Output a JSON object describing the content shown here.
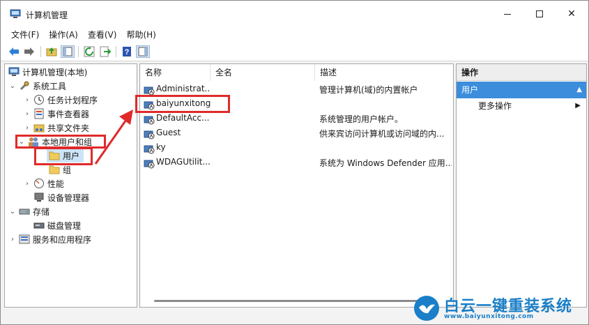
{
  "window": {
    "title": "计算机管理"
  },
  "menu": [
    "文件(F)",
    "操作(A)",
    "查看(V)",
    "帮助(H)"
  ],
  "tree": {
    "root": "计算机管理(本地)",
    "system_tools": "系统工具",
    "task_scheduler": "任务计划程序",
    "event_viewer": "事件查看器",
    "shared_folders": "共享文件夹",
    "local_users_groups": "本地用户和组",
    "users": "用户",
    "groups": "组",
    "performance": "性能",
    "device_manager": "设备管理器",
    "storage": "存储",
    "disk_management": "磁盘管理",
    "services_apps": "服务和应用程序"
  },
  "list": {
    "columns": [
      "名称",
      "全名",
      "描述"
    ],
    "rows": [
      {
        "name": "Administrat...",
        "fullname": "",
        "desc": "管理计算机(域)的内置帐户"
      },
      {
        "name": "baiyunxitong",
        "fullname": "",
        "desc": ""
      },
      {
        "name": "DefaultAcc...",
        "fullname": "",
        "desc": "系统管理的用户帐户。"
      },
      {
        "name": "Guest",
        "fullname": "",
        "desc": "供来宾访问计算机或访问域的内..."
      },
      {
        "name": "ky",
        "fullname": "",
        "desc": ""
      },
      {
        "name": "WDAGUtilit...",
        "fullname": "",
        "desc": "系统为 Windows Defender 应用..."
      }
    ]
  },
  "actions": {
    "header": "操作",
    "section": "用户",
    "more": "更多操作"
  },
  "watermark": {
    "title": "白云一键重装系统",
    "url": "www.baiyunxitong.com"
  },
  "colors": {
    "highlight": "#e02a2a",
    "accent": "#3c8ddc",
    "watermark": "#1a7ec8"
  }
}
